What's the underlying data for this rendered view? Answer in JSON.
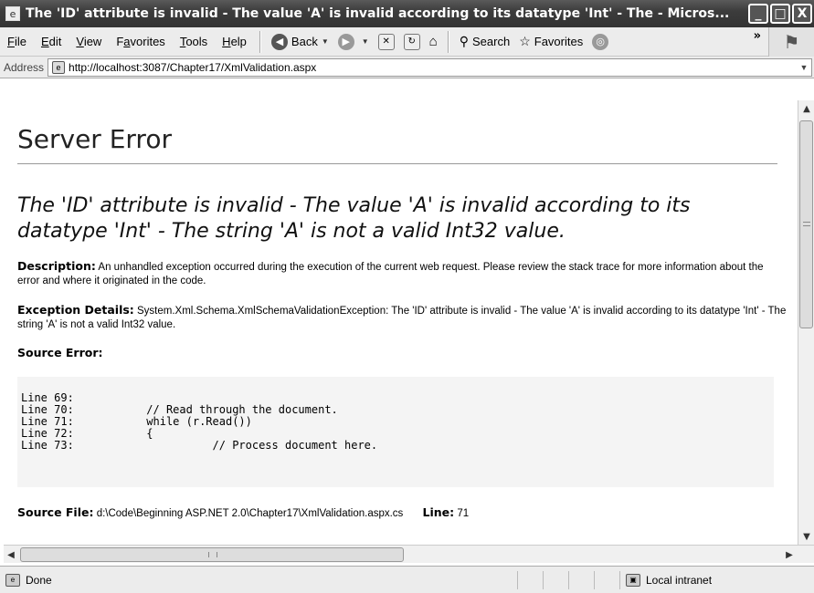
{
  "window": {
    "title": "The 'ID' attribute is invalid - The value 'A' is invalid according to its datatype 'Int' - The  - Micros...",
    "minimize_glyph": "_",
    "maximize_glyph": "□",
    "close_glyph": "X"
  },
  "menu": {
    "items": [
      "File",
      "Edit",
      "View",
      "Favorites",
      "Tools",
      "Help"
    ],
    "mnemonics": [
      "F",
      "E",
      "V",
      "a",
      "T",
      "H"
    ]
  },
  "toolbar": {
    "back_label": "Back",
    "search_label": "Search",
    "favorites_label": "Favorites",
    "overflow_glyph": "»"
  },
  "address": {
    "label": "Address",
    "url": "http://localhost:3087/Chapter17/XmlValidation.aspx"
  },
  "page": {
    "heading": "Server Error",
    "error_message": "The 'ID' attribute is invalid - The value 'A' is invalid according to its datatype 'Int' - The string 'A' is not a valid Int32 value.",
    "description_label": "Description:",
    "description_text": "An unhandled exception occurred during the execution of the current web request. Please review the stack trace for more information about the error and where it originated in the code.",
    "exception_label": "Exception Details:",
    "exception_text": "System.Xml.Schema.XmlSchemaValidationException: The 'ID' attribute is invalid - The value 'A' is invalid according to its datatype 'Int' - The string 'A' is not a valid Int32 value.",
    "source_error_label": "Source Error:",
    "code_lines": [
      "Line 69:",
      "Line 70:           // Read through the document.",
      "Line 71:           while (r.Read())",
      "Line 72:           {",
      "Line 73:                     // Process document here."
    ],
    "source_file_label": "Source File:",
    "source_file_path": "d:\\Code\\Beginning ASP.NET 2.0\\Chapter17\\XmlValidation.aspx.cs",
    "line_label": "Line:",
    "line_number": "71"
  },
  "status": {
    "text": "Done",
    "zone": "Local intranet"
  }
}
